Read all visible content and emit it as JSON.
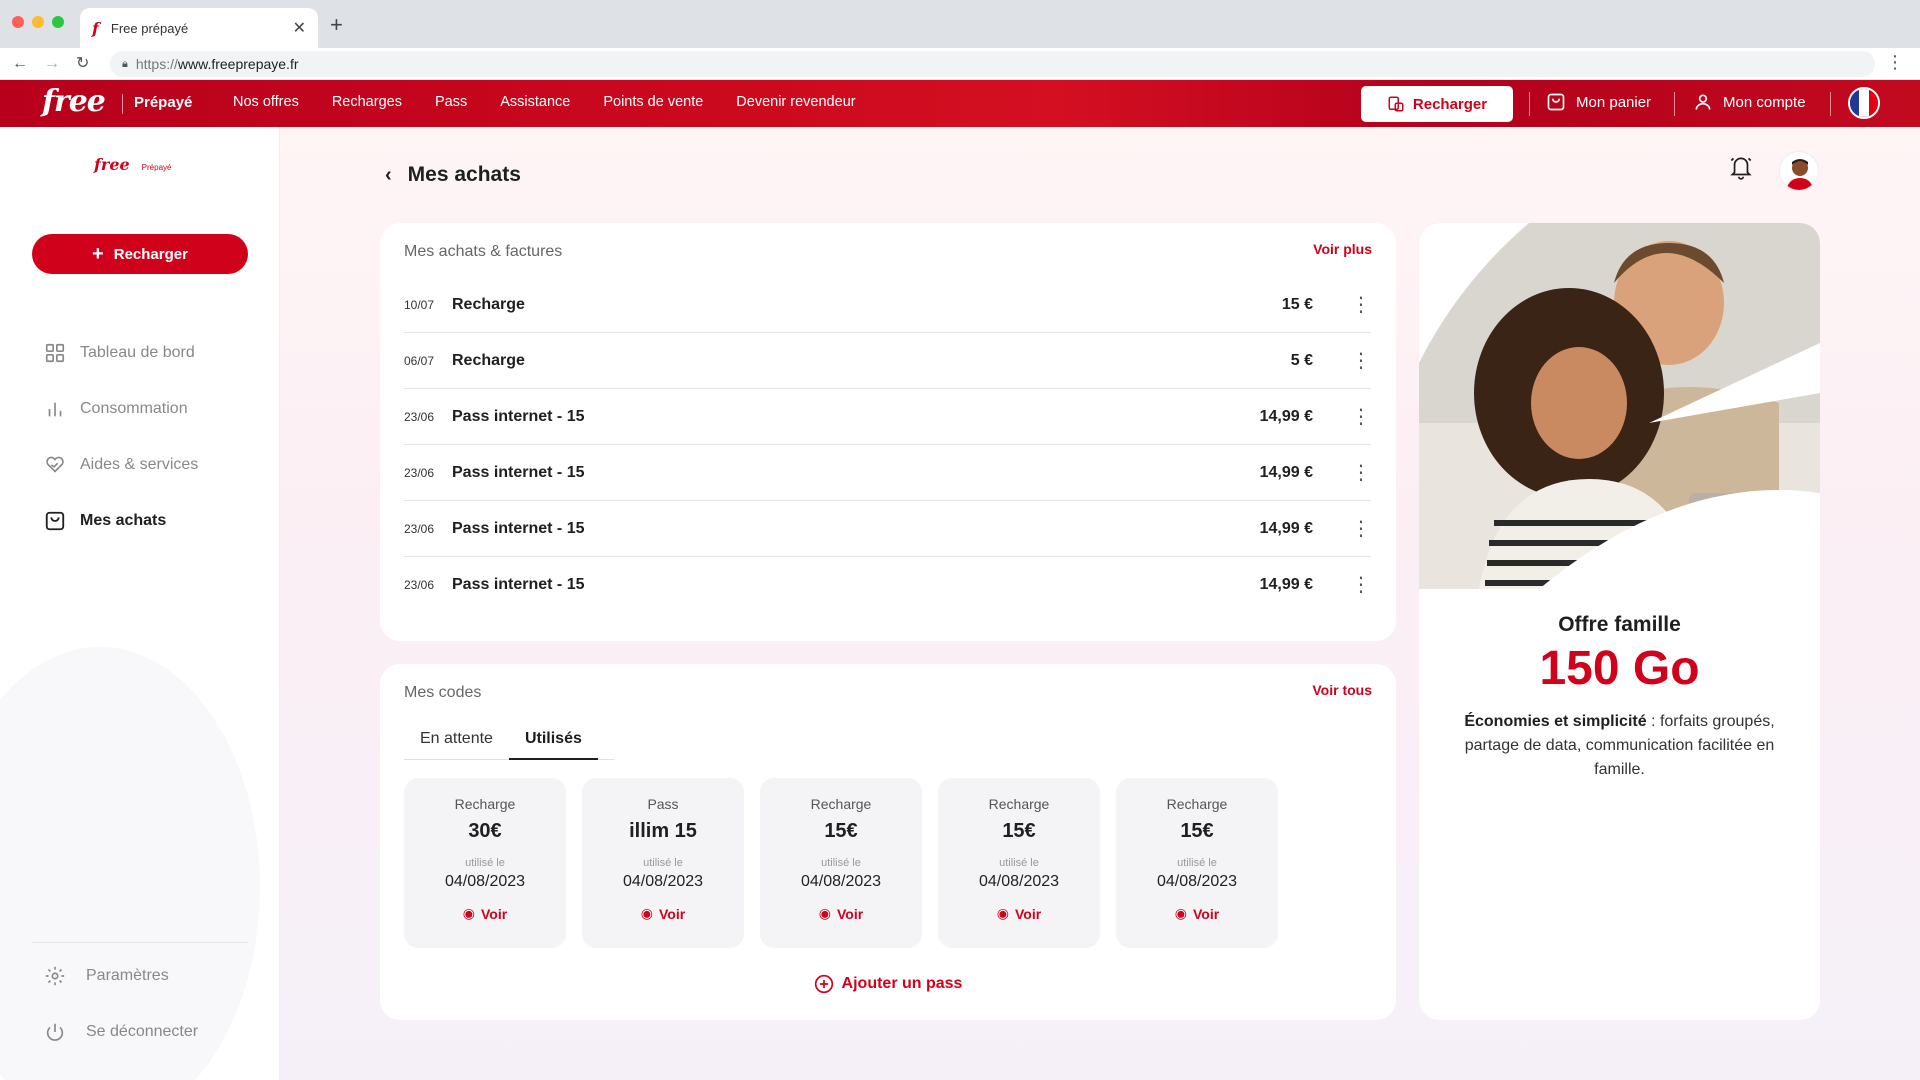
{
  "browser": {
    "tab_title": "Free prépayé",
    "url_protocol": "https://",
    "url_host": "www.freeprepaye.fr"
  },
  "header": {
    "logo": "free",
    "brand_suffix": "Prépayé",
    "nav": [
      "Nos offres",
      "Recharges",
      "Pass",
      "Assistance",
      "Points de vente",
      "Devenir revendeur"
    ],
    "recharge_button": "Recharger",
    "cart": "Mon panier",
    "account": "Mon compte"
  },
  "sidebar": {
    "logo": "free",
    "logo_suffix": "Prépayé",
    "recharge_button": "Recharger",
    "items": [
      {
        "label": "Tableau de bord",
        "icon": "grid-icon",
        "active": false
      },
      {
        "label": "Consommation",
        "icon": "bar-chart-icon",
        "active": false
      },
      {
        "label": "Aides & services",
        "icon": "heart-hands-icon",
        "active": false
      },
      {
        "label": "Mes achats",
        "icon": "bag-icon",
        "active": true
      }
    ],
    "bottom_items": [
      {
        "label": "Paramètres",
        "icon": "gear-icon"
      },
      {
        "label": "Se déconnecter",
        "icon": "power-icon"
      }
    ]
  },
  "main": {
    "title": "Mes achats",
    "purchases": {
      "heading": "Mes achats & factures",
      "link": "Voir plus",
      "rows": [
        {
          "date": "10/07",
          "label": "Recharge",
          "amount": "15 €"
        },
        {
          "date": "06/07",
          "label": "Recharge",
          "amount": "5 €"
        },
        {
          "date": "23/06",
          "label": "Pass internet - 15",
          "amount": "14,99 €"
        },
        {
          "date": "23/06",
          "label": "Pass internet - 15",
          "amount": "14,99 €"
        },
        {
          "date": "23/06",
          "label": "Pass internet - 15",
          "amount": "14,99 €"
        },
        {
          "date": "23/06",
          "label": "Pass internet - 15",
          "amount": "14,99 €"
        }
      ]
    },
    "codes": {
      "heading": "Mes codes",
      "link": "Voir tous",
      "tabs": [
        "En attente",
        "Utilisés"
      ],
      "selected_tab": "Utilisés",
      "items": [
        {
          "type": "Recharge",
          "value": "30€",
          "used_label": "utilisé le",
          "date": "04/08/2023",
          "action": "Voir"
        },
        {
          "type": "Pass",
          "value": "illim 15",
          "used_label": "utilisé le",
          "date": "04/08/2023",
          "action": "Voir"
        },
        {
          "type": "Recharge",
          "value": "15€",
          "used_label": "utilisé le",
          "date": "04/08/2023",
          "action": "Voir"
        },
        {
          "type": "Recharge",
          "value": "15€",
          "used_label": "utilisé le",
          "date": "04/08/2023",
          "action": "Voir"
        },
        {
          "type": "Recharge",
          "value": "15€",
          "used_label": "utilisé le",
          "date": "04/08/2023",
          "action": "Voir"
        }
      ],
      "add_button": "Ajouter un pass"
    }
  },
  "promo": {
    "title": "Offre famille",
    "highlight": "150 Go",
    "text_bold": "Économies et simplicité",
    "text_rest": " : forfaits groupés, partage de data, communication facilitée en famille."
  },
  "colors": {
    "brand_red": "#d0021b",
    "header_red": "#c40a1f"
  }
}
